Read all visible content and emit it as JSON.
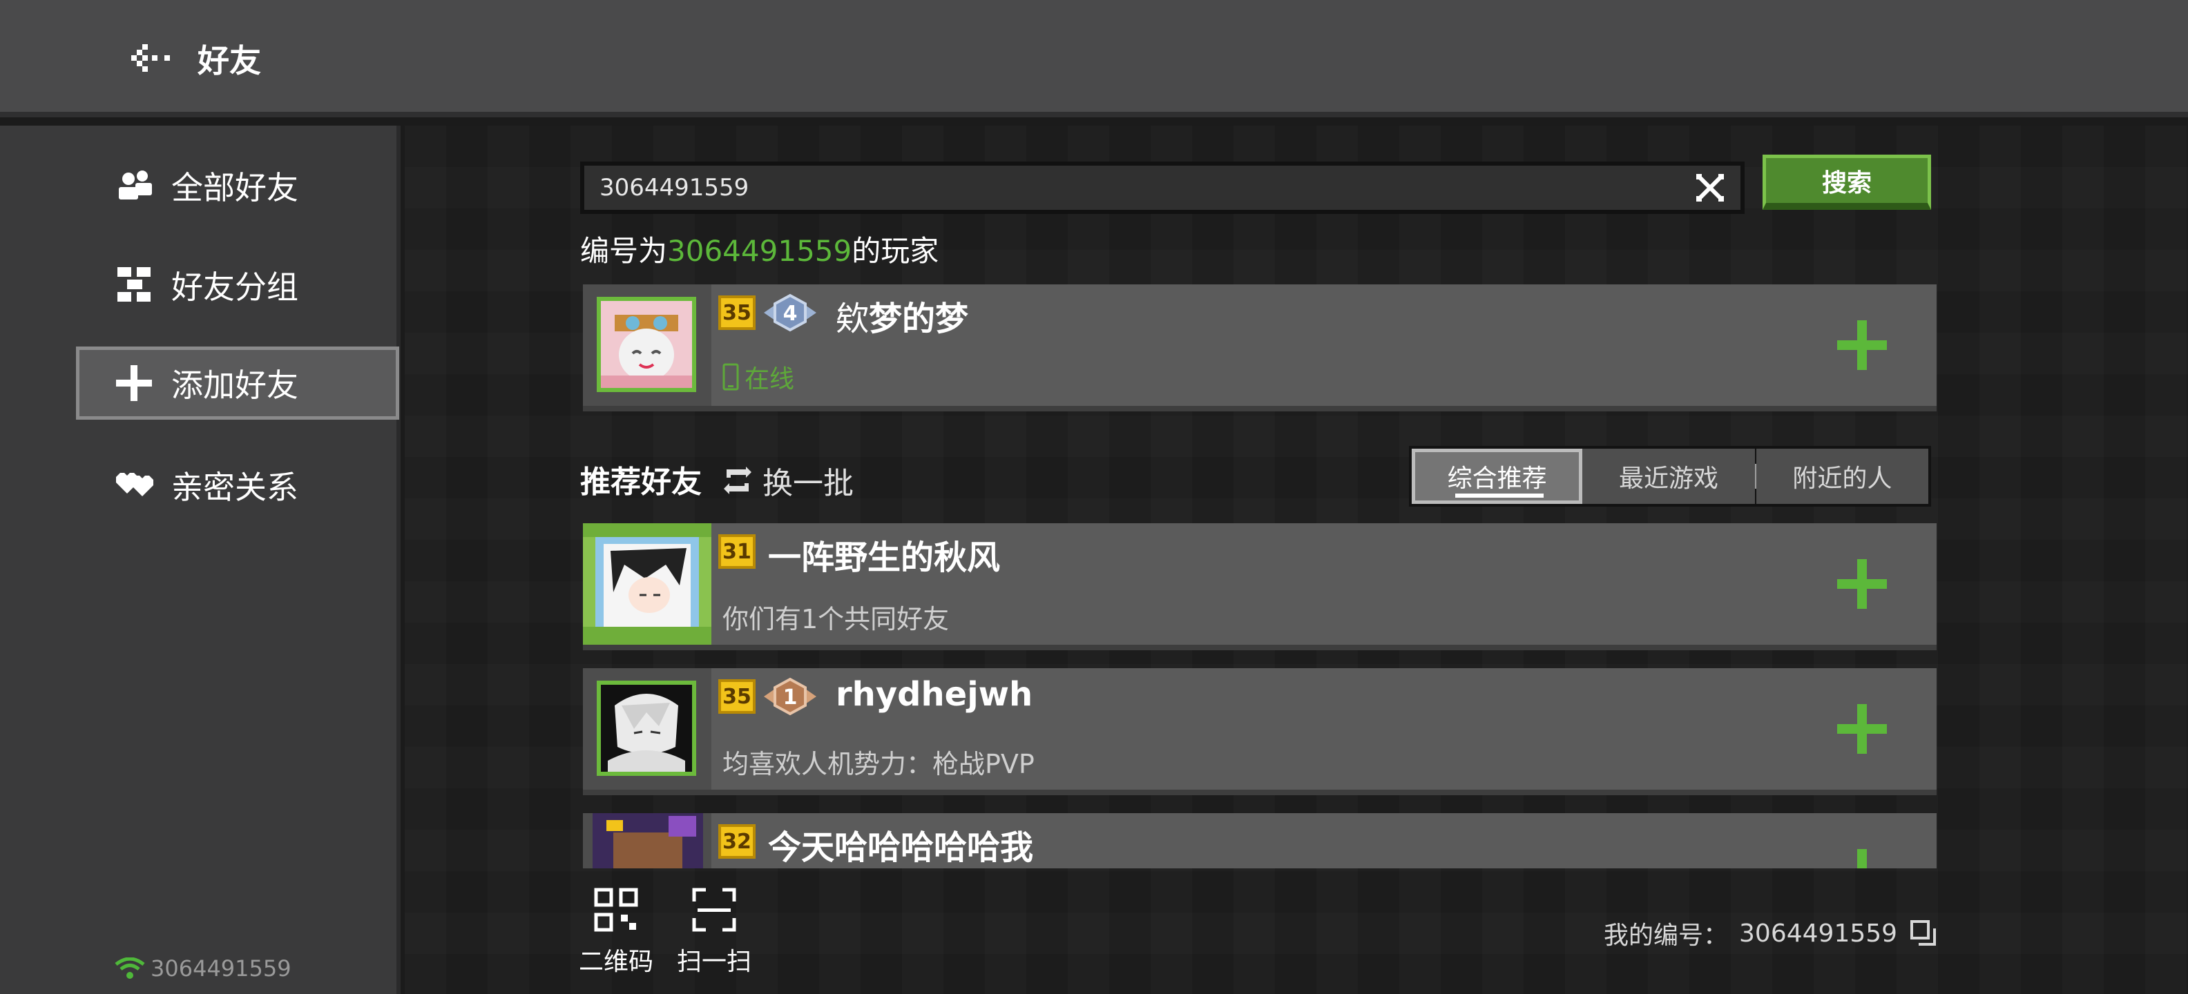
{
  "header": {
    "title": "好友",
    "back_icon": "back-arrow-icon"
  },
  "sidebar": {
    "items": [
      {
        "label": "全部好友",
        "icon": "friends-icon"
      },
      {
        "label": "好友分组",
        "icon": "group-icon"
      },
      {
        "label": "添加好友",
        "icon": "plus-icon",
        "active": true
      },
      {
        "label": "亲密关系",
        "icon": "hearts-icon"
      }
    ],
    "network_id": "3064491559"
  },
  "search": {
    "value": "3064491559",
    "button_label": "搜索"
  },
  "result": {
    "prefix": "编号为",
    "number": "3064491559",
    "suffix": "的玩家",
    "player": {
      "level": "35",
      "rank": "4",
      "name_prefix": "欸",
      "name": "梦的梦",
      "status": "在线"
    }
  },
  "recommend": {
    "title": "推荐好友",
    "refresh_label": "换一批",
    "tabs": [
      "综合推荐",
      "最近游戏",
      "附近的人"
    ],
    "active_tab": 0,
    "players": [
      {
        "level": "31",
        "name": "一阵野生的秋风",
        "sub": "你们有1个共同好友"
      },
      {
        "level": "35",
        "rank": "1",
        "name": "rhydhejwh",
        "sub": "均喜欢人机势力：枪战PVP"
      },
      {
        "level": "32",
        "name": "今天哈哈哈哈哈我"
      }
    ]
  },
  "bottom": {
    "qr_label": "二维码",
    "scan_label": "扫一扫",
    "my_id_label": "我的编号：",
    "my_id": "3064491559"
  },
  "colors": {
    "accent_green": "#5cb83a",
    "level_gold": "#f2c31a"
  }
}
